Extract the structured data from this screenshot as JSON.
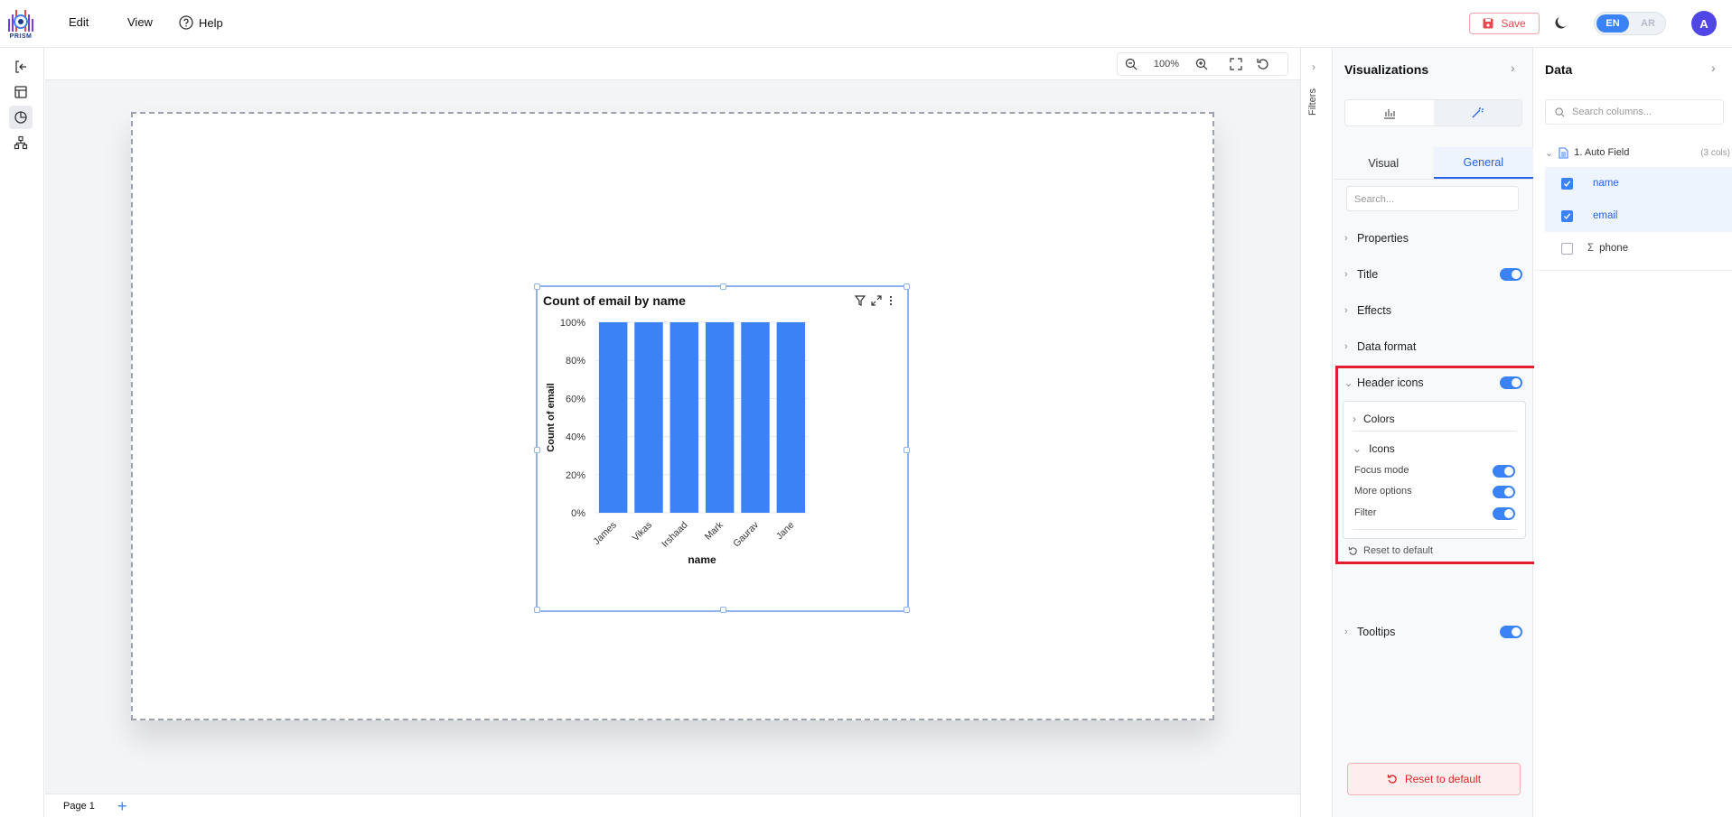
{
  "app": {
    "logo_text": "PRISM"
  },
  "menu": [
    {
      "label": "Edit"
    },
    {
      "label": "View"
    },
    {
      "label": "Help"
    }
  ],
  "topbar": {
    "save_label": "Save",
    "lang_en": "EN",
    "lang_ar": "AR",
    "avatar_initial": "A"
  },
  "toolbar": {
    "zoom": "100%"
  },
  "pages": {
    "current": "Page 1"
  },
  "filters": {
    "label": "Filters"
  },
  "visualizations": {
    "title": "Visualizations",
    "tabs": [
      "Visual",
      "General"
    ],
    "active_tab": "General",
    "search_placeholder": "Search...",
    "sections": [
      {
        "label": "Properties",
        "toggle": null
      },
      {
        "label": "Title",
        "toggle": true
      },
      {
        "label": "Effects",
        "toggle": null
      },
      {
        "label": "Data format",
        "toggle": null
      },
      {
        "label": "Header icons",
        "toggle": true,
        "expanded": true
      },
      {
        "label": "Tooltips",
        "toggle": true
      }
    ],
    "header_icons": {
      "colors_label": "Colors",
      "icons_label": "Icons",
      "options": [
        {
          "label": "Focus mode",
          "on": true
        },
        {
          "label": "More options",
          "on": true
        },
        {
          "label": "Filter",
          "on": true
        }
      ],
      "reset_label": "Reset to default"
    },
    "reset_all_label": "Reset to default"
  },
  "data_panel": {
    "title": "Data",
    "search_placeholder": "Search columns...",
    "group_label": "1. Auto Field",
    "group_count": "(3 cols)",
    "fields": [
      {
        "name": "name",
        "checked": true
      },
      {
        "name": "email",
        "checked": true
      },
      {
        "name": "phone",
        "checked": false,
        "measure": true
      }
    ]
  },
  "chart_data": {
    "type": "bar",
    "title": "Count of email by name",
    "xlabel": "name",
    "ylabel": "Count of email",
    "categories": [
      "James",
      "Vikas",
      "Irshaad",
      "Mark",
      "Gaurav",
      "Jane"
    ],
    "values": [
      100,
      100,
      100,
      100,
      100,
      100
    ],
    "yticks": [
      "0%",
      "20%",
      "40%",
      "60%",
      "80%",
      "100%"
    ],
    "ylim": [
      0,
      100
    ],
    "color": "#3b82f6",
    "grid": true
  },
  "colors": {
    "accent": "#3b82f6",
    "danger": "#e11d2e"
  }
}
